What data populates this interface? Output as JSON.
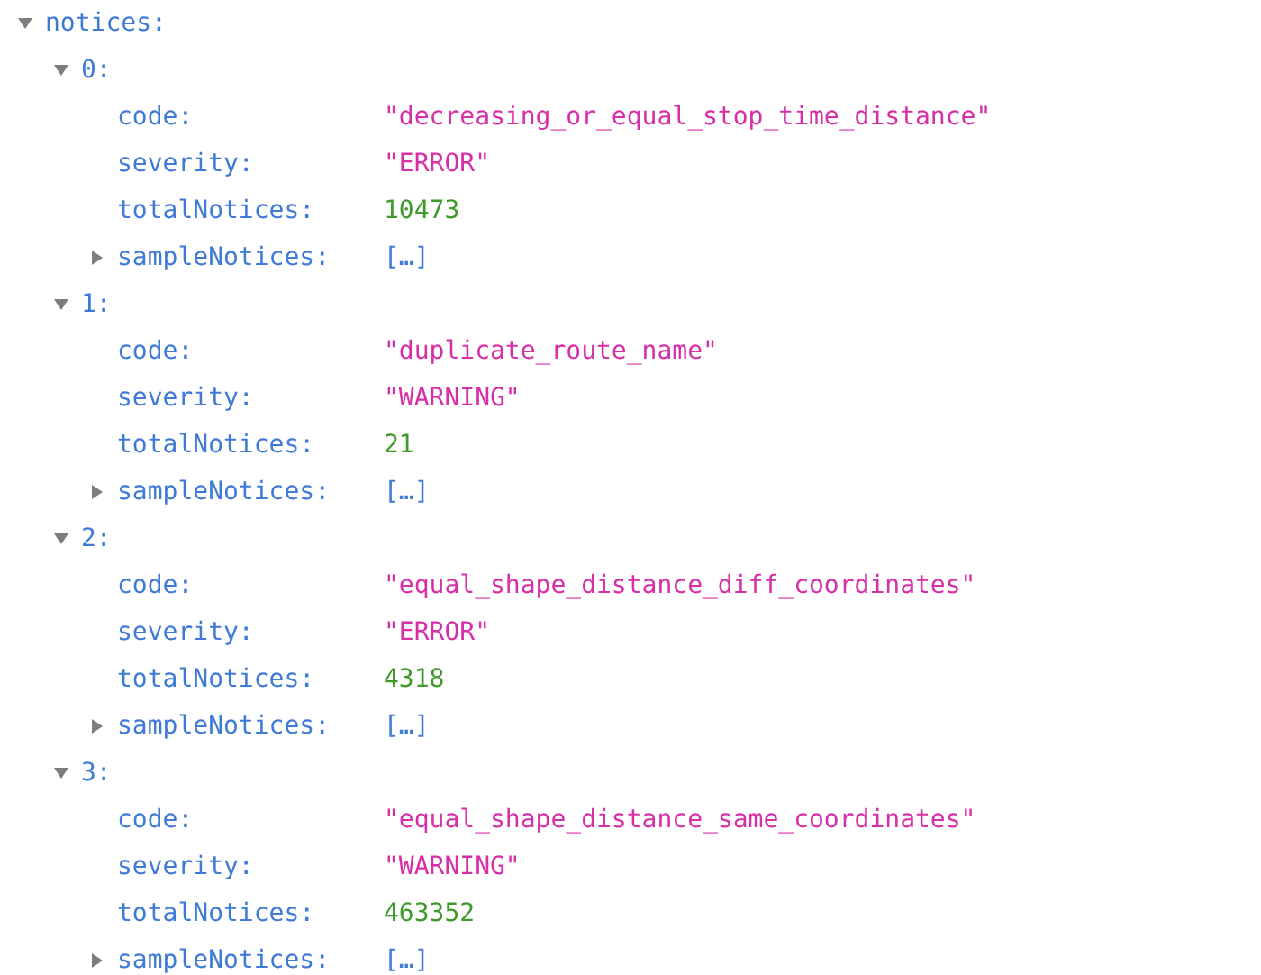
{
  "tree": [
    {
      "key": "notices:",
      "expanded": true,
      "children": [
        {
          "key": "0:",
          "expanded": true,
          "children": [
            {
              "key": "code:",
              "kind": "string",
              "value": "\"decreasing_or_equal_stop_time_distance\""
            },
            {
              "key": "severity:",
              "kind": "string",
              "value": "\"ERROR\""
            },
            {
              "key": "totalNotices:",
              "kind": "number",
              "value": "10473"
            },
            {
              "key": "sampleNotices:",
              "kind": "array",
              "value": "[…]",
              "expanded": false
            }
          ]
        },
        {
          "key": "1:",
          "expanded": true,
          "children": [
            {
              "key": "code:",
              "kind": "string",
              "value": "\"duplicate_route_name\""
            },
            {
              "key": "severity:",
              "kind": "string",
              "value": "\"WARNING\""
            },
            {
              "key": "totalNotices:",
              "kind": "number",
              "value": "21"
            },
            {
              "key": "sampleNotices:",
              "kind": "array",
              "value": "[…]",
              "expanded": false
            }
          ]
        },
        {
          "key": "2:",
          "expanded": true,
          "children": [
            {
              "key": "code:",
              "kind": "string",
              "value": "\"equal_shape_distance_diff_coordinates\""
            },
            {
              "key": "severity:",
              "kind": "string",
              "value": "\"ERROR\""
            },
            {
              "key": "totalNotices:",
              "kind": "number",
              "value": "4318"
            },
            {
              "key": "sampleNotices:",
              "kind": "array",
              "value": "[…]",
              "expanded": false
            }
          ]
        },
        {
          "key": "3:",
          "expanded": true,
          "children": [
            {
              "key": "code:",
              "kind": "string",
              "value": "\"equal_shape_distance_same_coordinates\""
            },
            {
              "key": "severity:",
              "kind": "string",
              "value": "\"WARNING\""
            },
            {
              "key": "totalNotices:",
              "kind": "number",
              "value": "463352"
            },
            {
              "key": "sampleNotices:",
              "kind": "array",
              "value": "[…]",
              "expanded": false
            }
          ]
        }
      ]
    }
  ]
}
